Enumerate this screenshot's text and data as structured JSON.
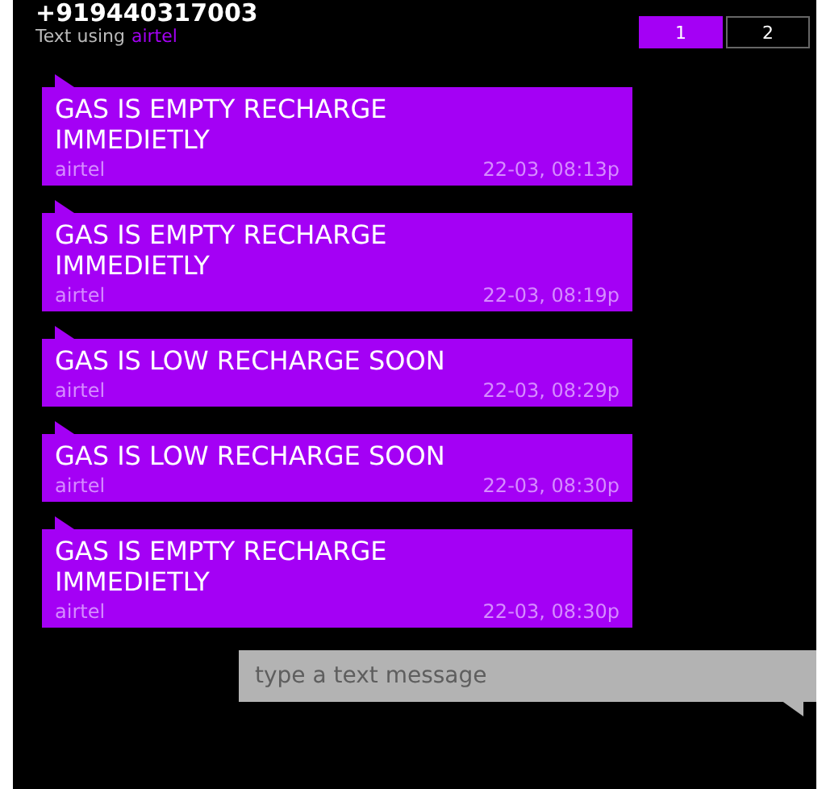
{
  "header": {
    "title": "+919440317003",
    "subtitle_prefix": "Text using",
    "carrier": "airtel"
  },
  "sim_tabs": [
    {
      "label": "1",
      "selected": true
    },
    {
      "label": "2",
      "selected": false
    }
  ],
  "messages": [
    {
      "text": "GAS IS EMPTY RECHARGE IMMEDIETLY",
      "sender": "airtel",
      "time": "22-03, 08:13p"
    },
    {
      "text": "GAS IS EMPTY RECHARGE IMMEDIETLY",
      "sender": "airtel",
      "time": "22-03, 08:19p"
    },
    {
      "text": "GAS IS LOW RECHARGE SOON",
      "sender": "airtel",
      "time": "22-03, 08:29p"
    },
    {
      "text": "GAS IS LOW RECHARGE SOON",
      "sender": "airtel",
      "time": "22-03, 08:30p"
    },
    {
      "text": "GAS IS EMPTY RECHARGE IMMEDIETLY",
      "sender": "airtel",
      "time": "22-03, 08:30p"
    }
  ],
  "compose": {
    "placeholder": "type a text message"
  }
}
